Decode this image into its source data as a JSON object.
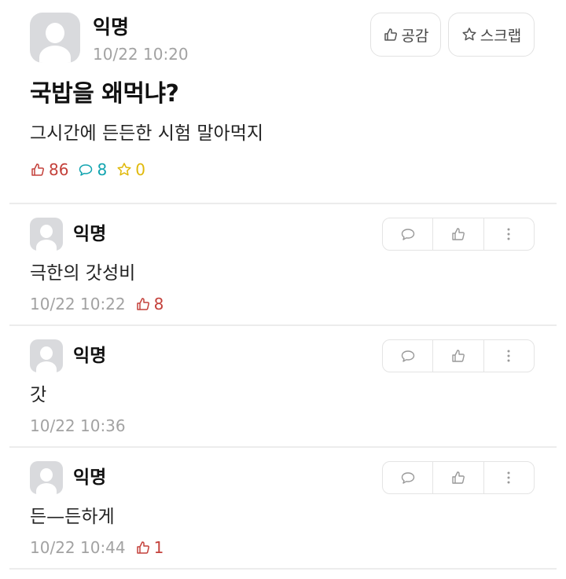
{
  "post": {
    "author": "익명",
    "time": "10/22 10:20",
    "like_button": "공감",
    "scrap_button": "스크랩",
    "title": "국밥을 왜먹냐?",
    "body": "그시간에 든든한 시험 말아먹지",
    "stats": {
      "likes": "86",
      "comments": "8",
      "scraps": "0"
    }
  },
  "comments": [
    {
      "author": "익명",
      "text": "극한의 갓성비",
      "time": "10/22 10:22",
      "likes": "8"
    },
    {
      "author": "익명",
      "text": "갓",
      "time": "10/22 10:36",
      "likes": ""
    },
    {
      "author": "익명",
      "text": "든—든하게",
      "time": "10/22 10:44",
      "likes": "1"
    }
  ],
  "colors": {
    "like": "#c4413b",
    "comment": "#12a4b0",
    "scrap": "#e0b90b",
    "muted": "#a2a2a2",
    "border": "#e2e2e2"
  },
  "icons": [
    "thumbs-up-icon",
    "star-icon",
    "speech-bubble-icon",
    "more-vertical-icon"
  ]
}
